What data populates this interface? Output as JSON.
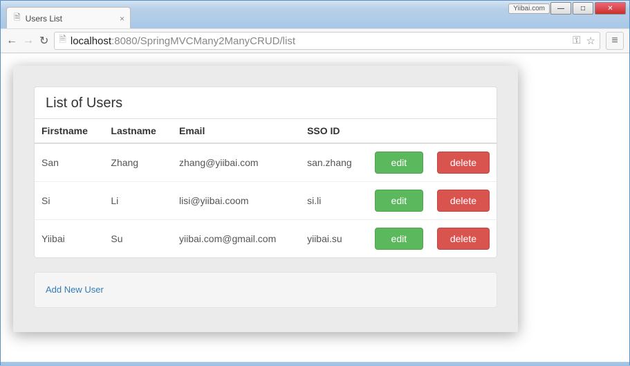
{
  "window": {
    "site_badge": "Yiibai.com"
  },
  "tab": {
    "title": "Users List"
  },
  "url": {
    "host": "localhost",
    "rest": ":8080/SpringMVCMany2ManyCRUD/list"
  },
  "page": {
    "heading": "List of Users",
    "add_link": "Add New User",
    "edit_label": "edit",
    "delete_label": "delete",
    "columns": {
      "firstname": "Firstname",
      "lastname": "Lastname",
      "email": "Email",
      "sso": "SSO ID"
    },
    "rows": [
      {
        "firstname": "San",
        "lastname": "Zhang",
        "email": "zhang@yiibai.com",
        "sso": "san.zhang"
      },
      {
        "firstname": "Si",
        "lastname": "Li",
        "email": "lisi@yiibai.coom",
        "sso": "si.li"
      },
      {
        "firstname": "Yiibai",
        "lastname": "Su",
        "email": "yiibai.com@gmail.com",
        "sso": "yiibai.su"
      }
    ]
  }
}
